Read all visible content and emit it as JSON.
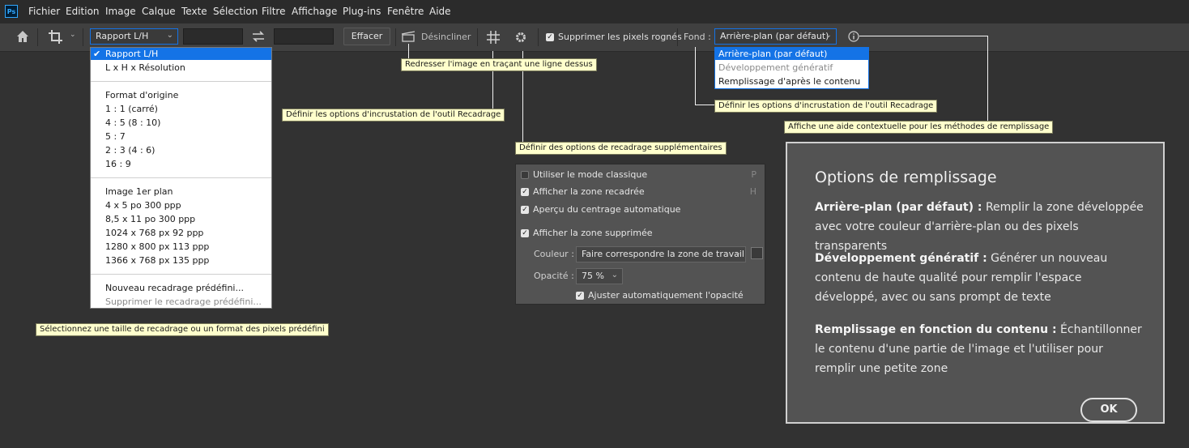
{
  "menubar": {
    "logo": "Ps",
    "items": [
      "Fichier",
      "Edition",
      "Image",
      "Calque",
      "Texte",
      "Sélection",
      "Filtre",
      "Affichage",
      "Plug-ins",
      "Fenêtre",
      "Aide"
    ]
  },
  "toolbar": {
    "home_icon": "home-icon",
    "crop_icon": "crop-tool-icon",
    "ratio_select": "Rapport L/H",
    "swap_icon": "swap-icon",
    "clear_button": "Effacer",
    "straighten_label": "Désincliner",
    "grid_icon": "overlay-grid-icon",
    "settings_icon": "gear-icon",
    "delete_cropped_label": "Supprimer les pixels rognés",
    "delete_cropped_checked": true,
    "fond_label": "Fond :",
    "fond_select": "Arrière-plan (par défaut)",
    "info_icon": "info-icon"
  },
  "preset_menu": {
    "items": [
      {
        "label": "Rapport L/H",
        "selected": true,
        "check": "✔"
      },
      {
        "label": "L x H x Résolution"
      },
      {
        "label": "Format d'origine"
      },
      {
        "label": "1 : 1 (carré)"
      },
      {
        "label": "4 : 5 (8 : 10)"
      },
      {
        "label": "5 : 7"
      },
      {
        "label": "2 : 3 (4 : 6)"
      },
      {
        "label": "16 : 9"
      },
      {
        "label": "Image 1er plan"
      },
      {
        "label": "4 x 5 po 300 ppp"
      },
      {
        "label": "8,5 x 11 po 300 ppp"
      },
      {
        "label": "1024 x 768 px 92 ppp"
      },
      {
        "label": "1280 x 800 px 113 ppp"
      },
      {
        "label": "1366 x 768 px 135 ppp"
      },
      {
        "label": "Nouveau recadrage prédéfini..."
      },
      {
        "label": "Supprimer le recadrage prédéfini...",
        "disabled": true
      }
    ]
  },
  "fond_menu": {
    "items": [
      {
        "label": "Arrière-plan (par défaut)",
        "selected": true
      },
      {
        "label": "Développement génératif",
        "disabled": true
      },
      {
        "label": "Remplissage d'après le contenu"
      }
    ]
  },
  "tooltips": {
    "straighten": "Redresser l'image en traçant une ligne dessus",
    "overlay_left": "Définir les options d'incrustation de l'outil Recadrage",
    "overlay_right": "Définir les options d'incrustation de l'outil Recadrage",
    "help": "Affiche une aide contextuelle pour les méthodes de remplissage",
    "extra": "Définir des options de recadrage supplémentaires",
    "preset": "Sélectionnez une taille de recadrage ou un format des pixels prédéfini"
  },
  "overlay_panel": {
    "classic_mode": {
      "label": "Utiliser le mode classique",
      "checked": false,
      "key": "P"
    },
    "show_cropped": {
      "label": "Afficher la zone recadrée",
      "checked": true,
      "key": "H"
    },
    "auto_center": {
      "label": "Aperçu du centrage automatique",
      "checked": true
    },
    "show_deleted": {
      "label": "Afficher la zone supprimée",
      "checked": true
    },
    "color_label": "Couleur :",
    "color_value": "Faire correspondre la zone de travail",
    "opacity_label": "Opacité :",
    "opacity_value": "75 %",
    "auto_opacity": {
      "label": "Ajuster automatiquement l'opacité",
      "checked": true
    }
  },
  "help_panel": {
    "title": "Options de remplissage",
    "p1_bold": "Arrière-plan (par défaut) :",
    "p1_text": " Remplir la zone développée avec votre couleur d'arrière-plan ou des pixels transparents",
    "p2_bold": "Développement génératif :",
    "p2_text": " Générer un nouveau contenu de haute qualité pour remplir l'espace développé, avec ou sans prompt de texte",
    "p3_bold": "Remplissage en fonction du contenu :",
    "p3_text": " Échantillonner le contenu d'une partie de l'image et l'utiliser pour remplir une petite zone",
    "ok_button": "OK"
  }
}
